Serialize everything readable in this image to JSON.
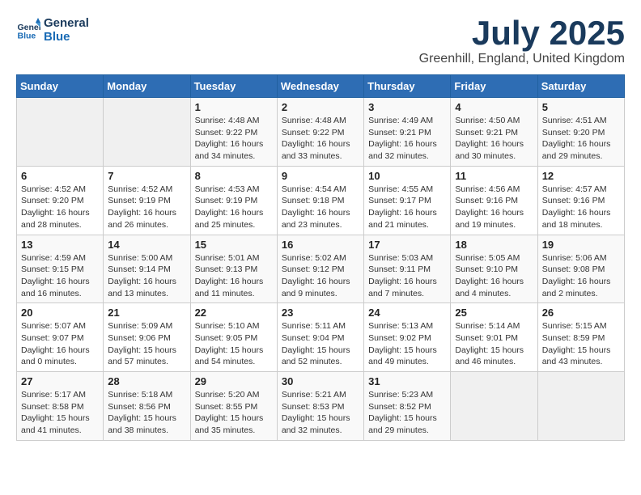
{
  "logo": {
    "line1": "General",
    "line2": "Blue"
  },
  "title": "July 2025",
  "subtitle": "Greenhill, England, United Kingdom",
  "days_header": [
    "Sunday",
    "Monday",
    "Tuesday",
    "Wednesday",
    "Thursday",
    "Friday",
    "Saturday"
  ],
  "weeks": [
    [
      {
        "day": "",
        "info": ""
      },
      {
        "day": "",
        "info": ""
      },
      {
        "day": "1",
        "info": "Sunrise: 4:48 AM\nSunset: 9:22 PM\nDaylight: 16 hours and 34 minutes."
      },
      {
        "day": "2",
        "info": "Sunrise: 4:48 AM\nSunset: 9:22 PM\nDaylight: 16 hours and 33 minutes."
      },
      {
        "day": "3",
        "info": "Sunrise: 4:49 AM\nSunset: 9:21 PM\nDaylight: 16 hours and 32 minutes."
      },
      {
        "day": "4",
        "info": "Sunrise: 4:50 AM\nSunset: 9:21 PM\nDaylight: 16 hours and 30 minutes."
      },
      {
        "day": "5",
        "info": "Sunrise: 4:51 AM\nSunset: 9:20 PM\nDaylight: 16 hours and 29 minutes."
      }
    ],
    [
      {
        "day": "6",
        "info": "Sunrise: 4:52 AM\nSunset: 9:20 PM\nDaylight: 16 hours and 28 minutes."
      },
      {
        "day": "7",
        "info": "Sunrise: 4:52 AM\nSunset: 9:19 PM\nDaylight: 16 hours and 26 minutes."
      },
      {
        "day": "8",
        "info": "Sunrise: 4:53 AM\nSunset: 9:19 PM\nDaylight: 16 hours and 25 minutes."
      },
      {
        "day": "9",
        "info": "Sunrise: 4:54 AM\nSunset: 9:18 PM\nDaylight: 16 hours and 23 minutes."
      },
      {
        "day": "10",
        "info": "Sunrise: 4:55 AM\nSunset: 9:17 PM\nDaylight: 16 hours and 21 minutes."
      },
      {
        "day": "11",
        "info": "Sunrise: 4:56 AM\nSunset: 9:16 PM\nDaylight: 16 hours and 19 minutes."
      },
      {
        "day": "12",
        "info": "Sunrise: 4:57 AM\nSunset: 9:16 PM\nDaylight: 16 hours and 18 minutes."
      }
    ],
    [
      {
        "day": "13",
        "info": "Sunrise: 4:59 AM\nSunset: 9:15 PM\nDaylight: 16 hours and 16 minutes."
      },
      {
        "day": "14",
        "info": "Sunrise: 5:00 AM\nSunset: 9:14 PM\nDaylight: 16 hours and 13 minutes."
      },
      {
        "day": "15",
        "info": "Sunrise: 5:01 AM\nSunset: 9:13 PM\nDaylight: 16 hours and 11 minutes."
      },
      {
        "day": "16",
        "info": "Sunrise: 5:02 AM\nSunset: 9:12 PM\nDaylight: 16 hours and 9 minutes."
      },
      {
        "day": "17",
        "info": "Sunrise: 5:03 AM\nSunset: 9:11 PM\nDaylight: 16 hours and 7 minutes."
      },
      {
        "day": "18",
        "info": "Sunrise: 5:05 AM\nSunset: 9:10 PM\nDaylight: 16 hours and 4 minutes."
      },
      {
        "day": "19",
        "info": "Sunrise: 5:06 AM\nSunset: 9:08 PM\nDaylight: 16 hours and 2 minutes."
      }
    ],
    [
      {
        "day": "20",
        "info": "Sunrise: 5:07 AM\nSunset: 9:07 PM\nDaylight: 16 hours and 0 minutes."
      },
      {
        "day": "21",
        "info": "Sunrise: 5:09 AM\nSunset: 9:06 PM\nDaylight: 15 hours and 57 minutes."
      },
      {
        "day": "22",
        "info": "Sunrise: 5:10 AM\nSunset: 9:05 PM\nDaylight: 15 hours and 54 minutes."
      },
      {
        "day": "23",
        "info": "Sunrise: 5:11 AM\nSunset: 9:04 PM\nDaylight: 15 hours and 52 minutes."
      },
      {
        "day": "24",
        "info": "Sunrise: 5:13 AM\nSunset: 9:02 PM\nDaylight: 15 hours and 49 minutes."
      },
      {
        "day": "25",
        "info": "Sunrise: 5:14 AM\nSunset: 9:01 PM\nDaylight: 15 hours and 46 minutes."
      },
      {
        "day": "26",
        "info": "Sunrise: 5:15 AM\nSunset: 8:59 PM\nDaylight: 15 hours and 43 minutes."
      }
    ],
    [
      {
        "day": "27",
        "info": "Sunrise: 5:17 AM\nSunset: 8:58 PM\nDaylight: 15 hours and 41 minutes."
      },
      {
        "day": "28",
        "info": "Sunrise: 5:18 AM\nSunset: 8:56 PM\nDaylight: 15 hours and 38 minutes."
      },
      {
        "day": "29",
        "info": "Sunrise: 5:20 AM\nSunset: 8:55 PM\nDaylight: 15 hours and 35 minutes."
      },
      {
        "day": "30",
        "info": "Sunrise: 5:21 AM\nSunset: 8:53 PM\nDaylight: 15 hours and 32 minutes."
      },
      {
        "day": "31",
        "info": "Sunrise: 5:23 AM\nSunset: 8:52 PM\nDaylight: 15 hours and 29 minutes."
      },
      {
        "day": "",
        "info": ""
      },
      {
        "day": "",
        "info": ""
      }
    ]
  ]
}
